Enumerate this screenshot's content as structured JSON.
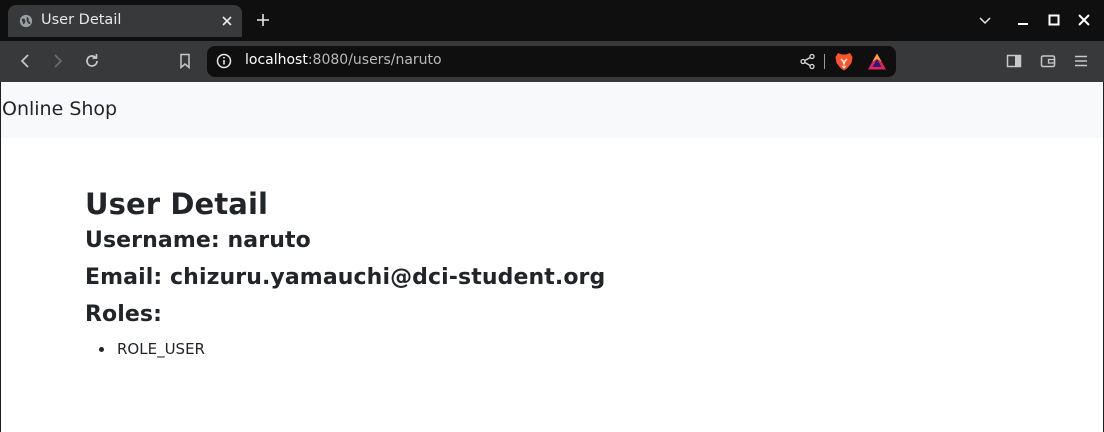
{
  "browser": {
    "tab": {
      "title": "User Detail",
      "favicon": "globe-icon"
    },
    "address_bar": {
      "host": "localhost",
      "rest": ":8080/users/naruto"
    },
    "icons": {
      "back": "arrow-left-icon",
      "forward": "arrow-right-icon",
      "reload": "reload-icon",
      "bookmark": "bookmark-icon",
      "site_info": "info-icon",
      "share": "share-icon",
      "brave_shields": "brave-lion-icon",
      "brave_rewards": "brave-rewards-icon",
      "sidebar": "sidebar-icon",
      "wallet": "wallet-icon",
      "menu": "hamburger-menu-icon"
    },
    "colors": {
      "tabstrip": "#0f0f10",
      "toolbar": "#38393b",
      "brave_orange": "#fb542b"
    }
  },
  "page": {
    "navbar": {
      "brand": "Online Shop"
    },
    "title": "User Detail",
    "username_line": "Username: naruto",
    "email_line": "Email: chizuru.yamauchi@dci-student.org",
    "roles_heading": "Roles:",
    "roles": [
      "ROLE_USER"
    ]
  }
}
